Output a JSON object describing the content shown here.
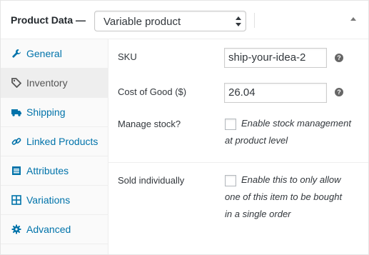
{
  "header": {
    "title": "Product Data",
    "dash": "—",
    "product_type": "Variable product"
  },
  "tabs": [
    {
      "label": "General",
      "icon": "wrench-icon",
      "active": false
    },
    {
      "label": "Inventory",
      "icon": "tag-icon",
      "active": true
    },
    {
      "label": "Shipping",
      "icon": "truck-icon",
      "active": false
    },
    {
      "label": "Linked Products",
      "icon": "link-icon",
      "active": false
    },
    {
      "label": "Attributes",
      "icon": "list-icon",
      "active": false
    },
    {
      "label": "Variations",
      "icon": "grid-icon",
      "active": false
    },
    {
      "label": "Advanced",
      "icon": "gear-icon",
      "active": false
    }
  ],
  "inventory": {
    "sku_label": "SKU",
    "sku_value": "ship-your-idea-2",
    "cost_label": "Cost of Good ($)",
    "cost_value": "26.04",
    "manage_stock_label": "Manage stock?",
    "manage_stock_desc_1": "Enable stock management",
    "manage_stock_desc_2": "at product level",
    "sold_individually_label": "Sold individually",
    "sold_desc_1": "Enable this to only allow",
    "sold_desc_2": "one of this item to be bought",
    "sold_desc_3": "in a single order",
    "help_glyph": "?"
  },
  "colors": {
    "link": "#0073aa",
    "active_tab_bg": "#eeeeee",
    "tabs_bg": "#fafafa"
  }
}
